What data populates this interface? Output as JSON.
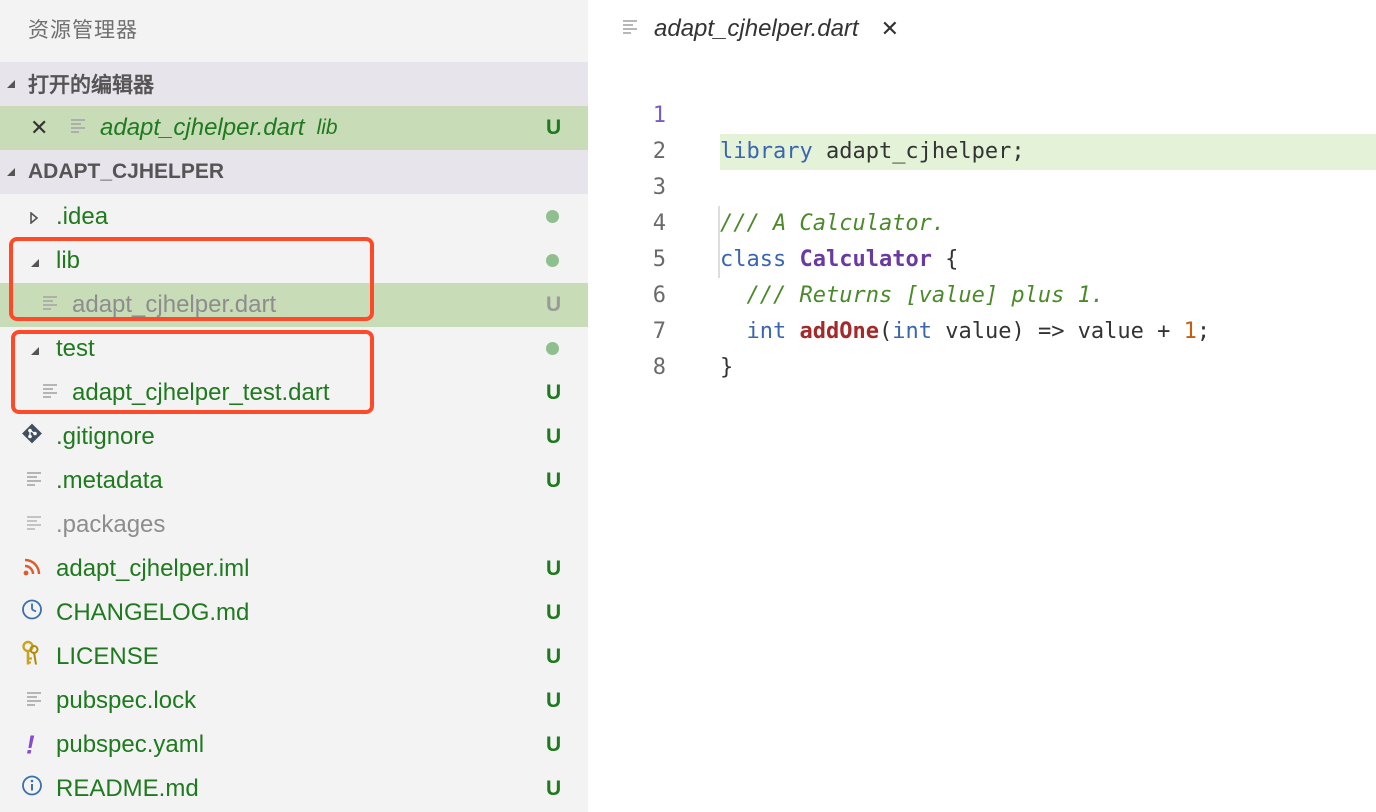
{
  "sidebar": {
    "title": "资源管理器",
    "open_editors": {
      "header": "打开的编辑器",
      "items": [
        {
          "name": "adapt_cjhelper.dart",
          "hint": "lib",
          "badge": "U"
        }
      ]
    },
    "project": {
      "header": "ADAPT_CJHELPER",
      "items": [
        {
          "name": ".idea",
          "badge": ""
        },
        {
          "name": "lib",
          "badge": ""
        },
        {
          "name": "adapt_cjhelper.dart",
          "badge": "U"
        },
        {
          "name": "test",
          "badge": ""
        },
        {
          "name": "adapt_cjhelper_test.dart",
          "badge": "U"
        },
        {
          "name": ".gitignore",
          "badge": "U"
        },
        {
          "name": ".metadata",
          "badge": "U"
        },
        {
          "name": ".packages",
          "badge": ""
        },
        {
          "name": "adapt_cjhelper.iml",
          "badge": "U"
        },
        {
          "name": "CHANGELOG.md",
          "badge": "U"
        },
        {
          "name": "LICENSE",
          "badge": "U"
        },
        {
          "name": "pubspec.lock",
          "badge": "U"
        },
        {
          "name": "pubspec.yaml",
          "badge": "U"
        },
        {
          "name": "README.md",
          "badge": "U"
        }
      ]
    }
  },
  "editor": {
    "tab_label": "adapt_cjhelper.dart",
    "line_numbers": [
      "1",
      "2",
      "3",
      "4",
      "5",
      "6",
      "7",
      "8"
    ],
    "code": {
      "l1_kw": "library",
      "l1_rest": " adapt_cjhelper;",
      "l3_comment": "/// A Calculator.",
      "l4_kw": "class",
      "l4_type": "Calculator",
      "l4_rest": " {",
      "l5_comment": "/// Returns [value] plus 1.",
      "l6_kw1": "int",
      "l6_fn": "addOne",
      "l6_paren": "(",
      "l6_kw2": "int",
      "l6_mid": " value) => value + ",
      "l6_num": "1",
      "l6_end": ";",
      "l7": "}"
    }
  },
  "colors": {
    "sidebar_bg": "#f3f3f3",
    "section_header_bg": "#e8e4ec",
    "selected_row_bg": "#c9dcb8",
    "git_untracked": "#1f7a1f",
    "highlight_box": "#ff4a2a",
    "active_line_bg": "#e4f3d8"
  }
}
